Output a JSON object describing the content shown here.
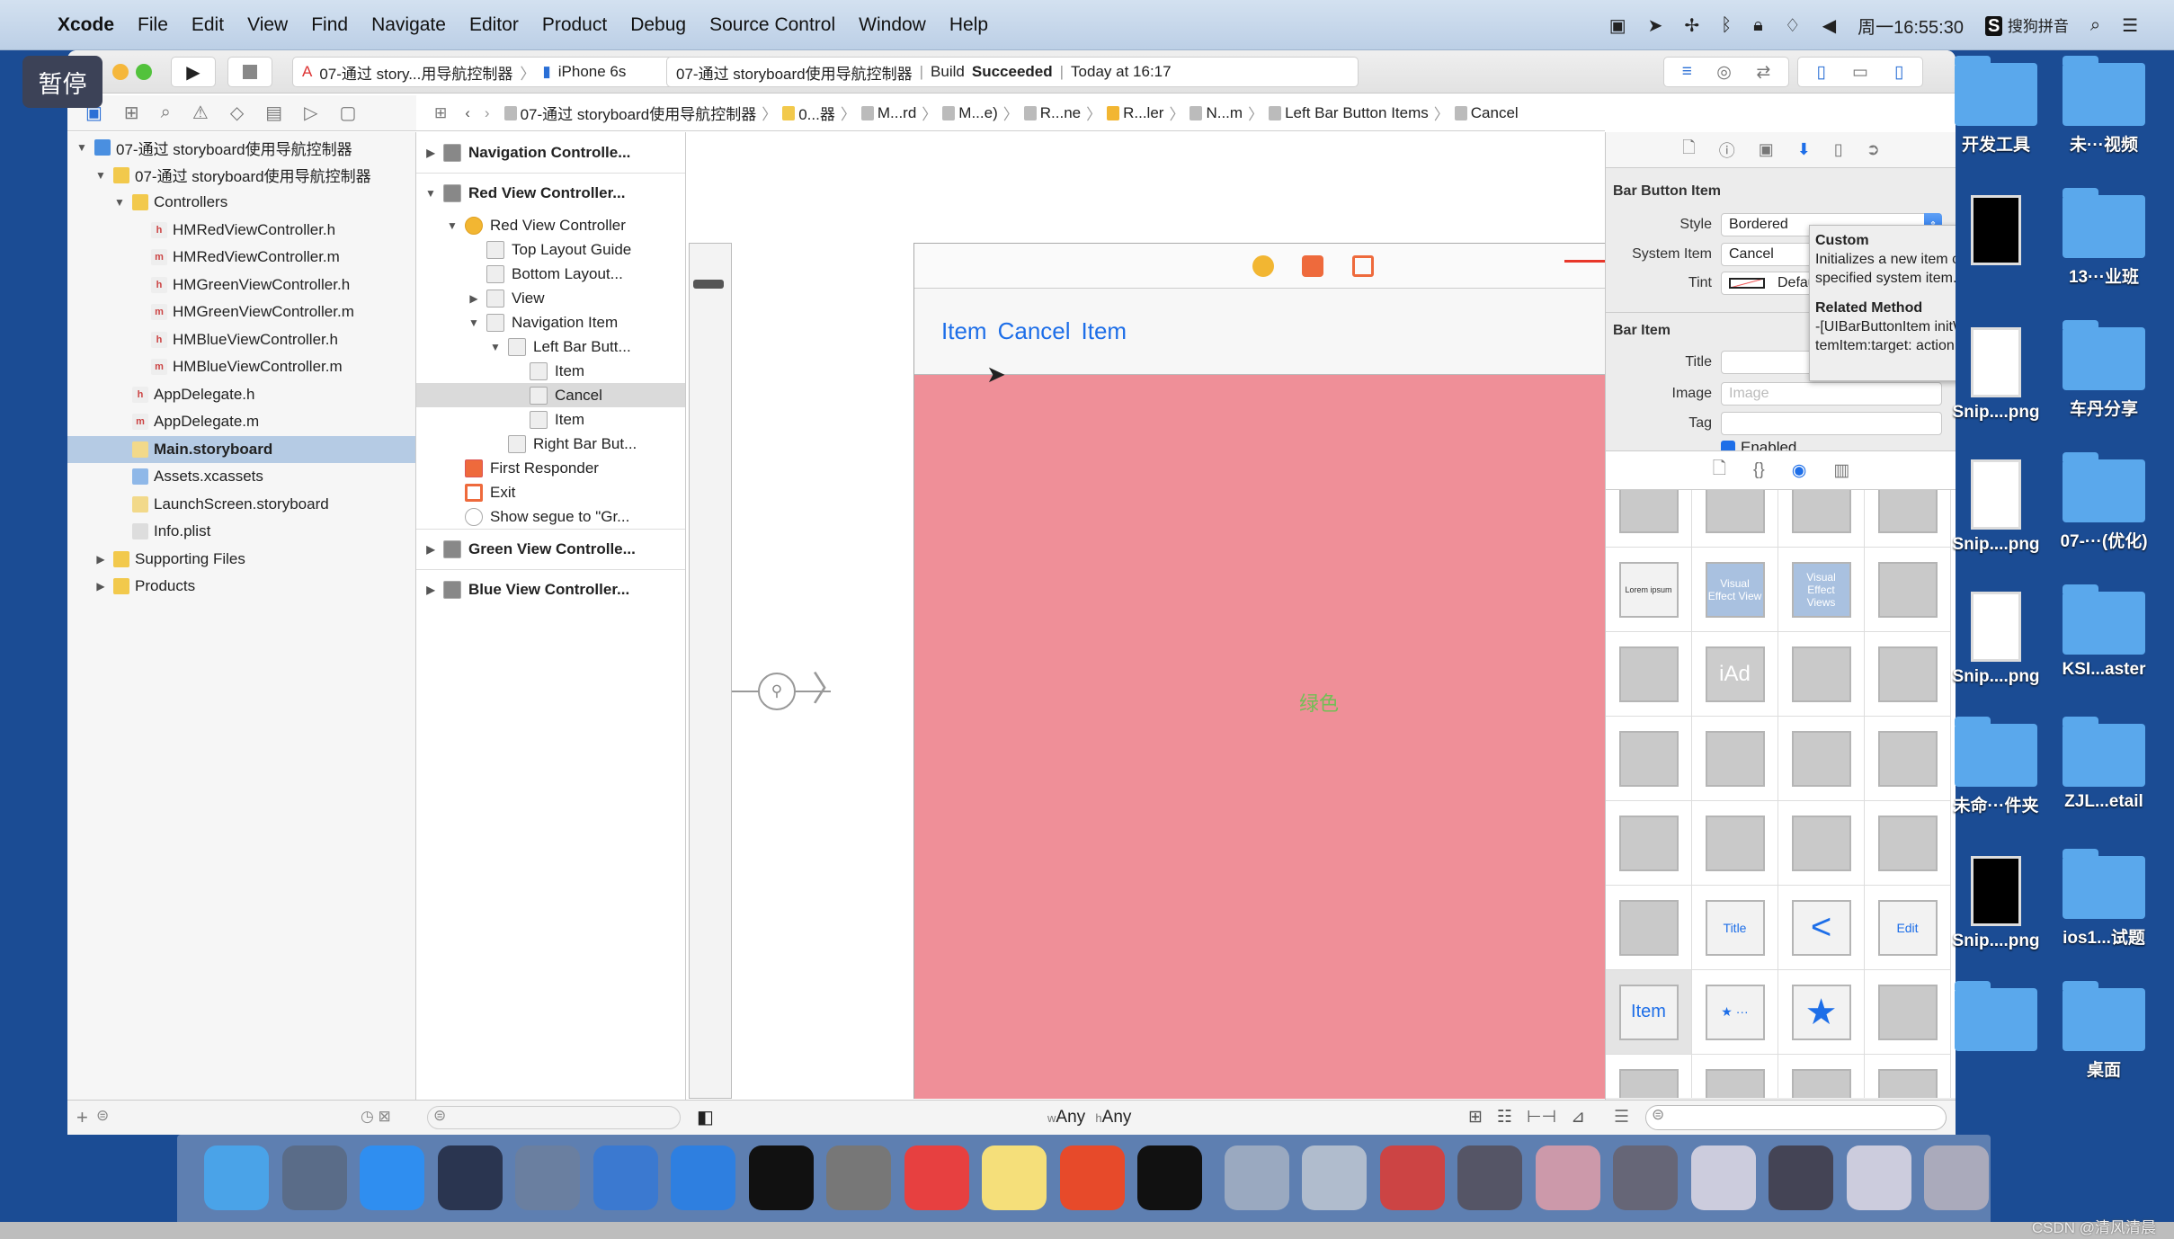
{
  "menubar": {
    "app": "Xcode",
    "items": [
      "File",
      "Edit",
      "View",
      "Find",
      "Navigate",
      "Editor",
      "Product",
      "Debug",
      "Source Control",
      "Window",
      "Help"
    ],
    "clock": "周一16:55:30",
    "ime": "搜狗拼音"
  },
  "overlay": {
    "label": "暂停"
  },
  "toolbar": {
    "scheme": "07-通过 story...用导航控制器",
    "device": "iPhone 6s",
    "project": "07-通过 storyboard使用导航控制器",
    "build_label": "Build",
    "build_status": "Succeeded",
    "time": "Today at 16:17"
  },
  "jumpbar": [
    "07-通过 storyboard使用导航控制器",
    "0...器",
    "M...rd",
    "M...e)",
    "R...ne",
    "R...ler",
    "N...m",
    "Left Bar Button Items",
    "Cancel"
  ],
  "navigator": {
    "items": [
      {
        "label": "07-通过 storyboard使用导航控制器",
        "level": 0,
        "tri": "▼",
        "icon": "project"
      },
      {
        "label": "07-通过 storyboard使用导航控制器",
        "level": 1,
        "tri": "▼",
        "icon": "folder"
      },
      {
        "label": "Controllers",
        "level": 2,
        "tri": "▼",
        "icon": "folder"
      },
      {
        "label": "HMRedViewController.h",
        "level": 3,
        "icon": "h"
      },
      {
        "label": "HMRedViewController.m",
        "level": 3,
        "icon": "m"
      },
      {
        "label": "HMGreenViewController.h",
        "level": 3,
        "icon": "h"
      },
      {
        "label": "HMGreenViewController.m",
        "level": 3,
        "icon": "m"
      },
      {
        "label": "HMBlueViewController.h",
        "level": 3,
        "icon": "h"
      },
      {
        "label": "HMBlueViewController.m",
        "level": 3,
        "icon": "m"
      },
      {
        "label": "AppDelegate.h",
        "level": 2,
        "icon": "h"
      },
      {
        "label": "AppDelegate.m",
        "level": 2,
        "icon": "m"
      },
      {
        "label": "Main.storyboard",
        "level": 2,
        "icon": "storyboard",
        "selected": true
      },
      {
        "label": "Assets.xcassets",
        "level": 2,
        "icon": "assets"
      },
      {
        "label": "LaunchScreen.storyboard",
        "level": 2,
        "icon": "storyboard"
      },
      {
        "label": "Info.plist",
        "level": 2,
        "icon": "plist"
      },
      {
        "label": "Supporting Files",
        "level": 1,
        "tri": "▶",
        "icon": "folder"
      },
      {
        "label": "Products",
        "level": 1,
        "tri": "▶",
        "icon": "folder"
      }
    ]
  },
  "outline": {
    "items": [
      {
        "label": "Navigation Controlle...",
        "level": 0,
        "tri": "▶",
        "bold": true
      },
      {
        "label": "Red View Controller...",
        "level": 0,
        "tri": "▼",
        "bold": true
      },
      {
        "label": "Red View Controller",
        "level": 1,
        "tri": "▼",
        "icon": "vc"
      },
      {
        "label": "Top Layout Guide",
        "level": 2
      },
      {
        "label": "Bottom Layout...",
        "level": 2
      },
      {
        "label": "View",
        "level": 2,
        "tri": "▶"
      },
      {
        "label": "Navigation Item",
        "level": 2,
        "tri": "▼"
      },
      {
        "label": "Left Bar Butt...",
        "level": 3,
        "tri": "▼"
      },
      {
        "label": "Item",
        "level": 4
      },
      {
        "label": "Cancel",
        "level": 4,
        "selected": true
      },
      {
        "label": "Item",
        "level": 4
      },
      {
        "label": "Right Bar But...",
        "level": 3
      },
      {
        "label": "First Responder",
        "level": 1,
        "icon": "responder"
      },
      {
        "label": "Exit",
        "level": 1,
        "icon": "exit"
      },
      {
        "label": "Show segue to \"Gr...",
        "level": 1,
        "icon": "segue"
      },
      {
        "label": "Green View Controlle...",
        "level": 0,
        "tri": "▶",
        "bold": true
      },
      {
        "label": "Blue View Controller...",
        "level": 0,
        "tri": "▶",
        "bold": true
      }
    ]
  },
  "canvas": {
    "nav_items": [
      "Item",
      "Cancel",
      "Item"
    ],
    "view_label": "绿色",
    "view_color": "#ef8f98",
    "label_color": "#5cc84a",
    "size_class_w": "w",
    "size_class_w_value": "Any",
    "size_class_h": "h",
    "size_class_h_value": "Any"
  },
  "inspector": {
    "bar_button_item": {
      "title": "Bar Button Item",
      "style_label": "Style",
      "style_value": "Bordered",
      "system_item_label": "System Item",
      "system_item_value": "Cancel",
      "tint_label": "Tint",
      "tint_value": "Default"
    },
    "bar_item": {
      "title": "Bar Item",
      "title_label": "Title",
      "title_value": "",
      "image_label": "Image",
      "image_placeholder": "Image",
      "tag_label": "Tag",
      "enabled_label": "Enabled"
    },
    "tooltip": {
      "title": "Custom",
      "body": "Initializes a new item containing the specified system item.",
      "related_title": "Related Method",
      "method": "-[UIBarButtonItem initWithBarButtonSystemItem:target: action:]"
    }
  },
  "library": {
    "tiles": [
      "",
      "",
      "",
      "",
      "Lorem ipsum",
      "Visual Effect View",
      "Visual Effect Views",
      "",
      "",
      "iAd",
      "",
      "",
      "",
      "",
      "",
      "",
      "",
      "",
      "",
      "",
      "",
      "Title",
      "<",
      "Edit",
      "Item",
      "★ ···",
      "★",
      "",
      "",
      "",
      "",
      ""
    ]
  },
  "desktop": {
    "col1": [
      "开发工具",
      "",
      "Snip....png",
      "Snip....png",
      "Snip....png",
      "未命···件夹",
      "Snip....png",
      ""
    ],
    "col2": [
      "未···视频",
      "13···业班",
      "车丹分享",
      "07-···(优化)",
      "KSI...aster",
      "ZJL...etail",
      "ios1...试题",
      "桌面"
    ]
  },
  "watermark": "CSDN @清风清晨",
  "colors": {
    "accent": "#1d6ee8",
    "annotation_arrow": "#e8372a"
  }
}
